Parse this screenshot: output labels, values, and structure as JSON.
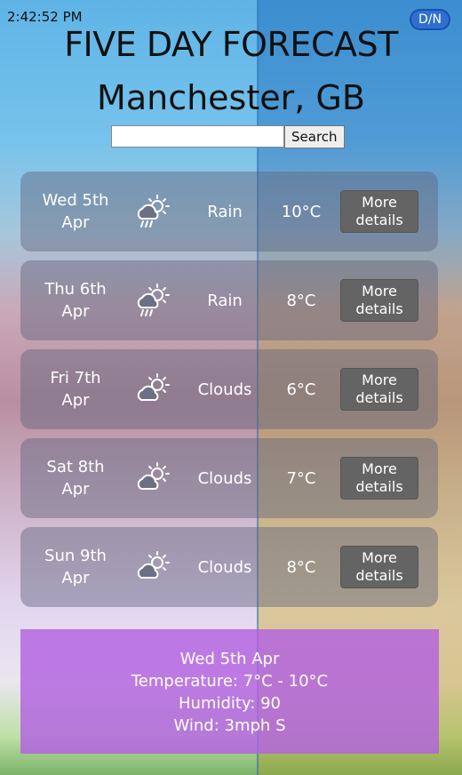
{
  "header": {
    "time": "2:42:52 PM",
    "toggle_label": "D/N",
    "title": "FIVE DAY FORECAST",
    "location": "Manchester, GB"
  },
  "search": {
    "value": "",
    "placeholder": "",
    "button_label": "Search"
  },
  "days": [
    {
      "date_line1": "Wed 5th",
      "date_line2": "Apr",
      "icon": "rain-cloud-sun-icon",
      "condition": "Rain",
      "temp": "10°C",
      "more_line1": "More",
      "more_line2": "details"
    },
    {
      "date_line1": "Thu 6th",
      "date_line2": "Apr",
      "icon": "rain-cloud-sun-icon",
      "condition": "Rain",
      "temp": "8°C",
      "more_line1": "More",
      "more_line2": "details"
    },
    {
      "date_line1": "Fri 7th",
      "date_line2": "Apr",
      "icon": "cloud-sun-icon",
      "condition": "Clouds",
      "temp": "6°C",
      "more_line1": "More",
      "more_line2": "details"
    },
    {
      "date_line1": "Sat 8th",
      "date_line2": "Apr",
      "icon": "cloud-sun-icon",
      "condition": "Clouds",
      "temp": "7°C",
      "more_line1": "More",
      "more_line2": "details"
    },
    {
      "date_line1": "Sun 9th",
      "date_line2": "Apr",
      "icon": "cloud-sun-icon",
      "condition": "Clouds",
      "temp": "8°C",
      "more_line1": "More",
      "more_line2": "details"
    }
  ],
  "details": {
    "date": "Wed 5th Apr",
    "temperature": "Temperature: 7°C - 10°C",
    "humidity": "Humidity: 90",
    "wind": "Wind: 3mph S"
  },
  "colors": {
    "card": "#5f647d",
    "details_panel": "#b262e1",
    "toggle": "#2f6fd0"
  }
}
